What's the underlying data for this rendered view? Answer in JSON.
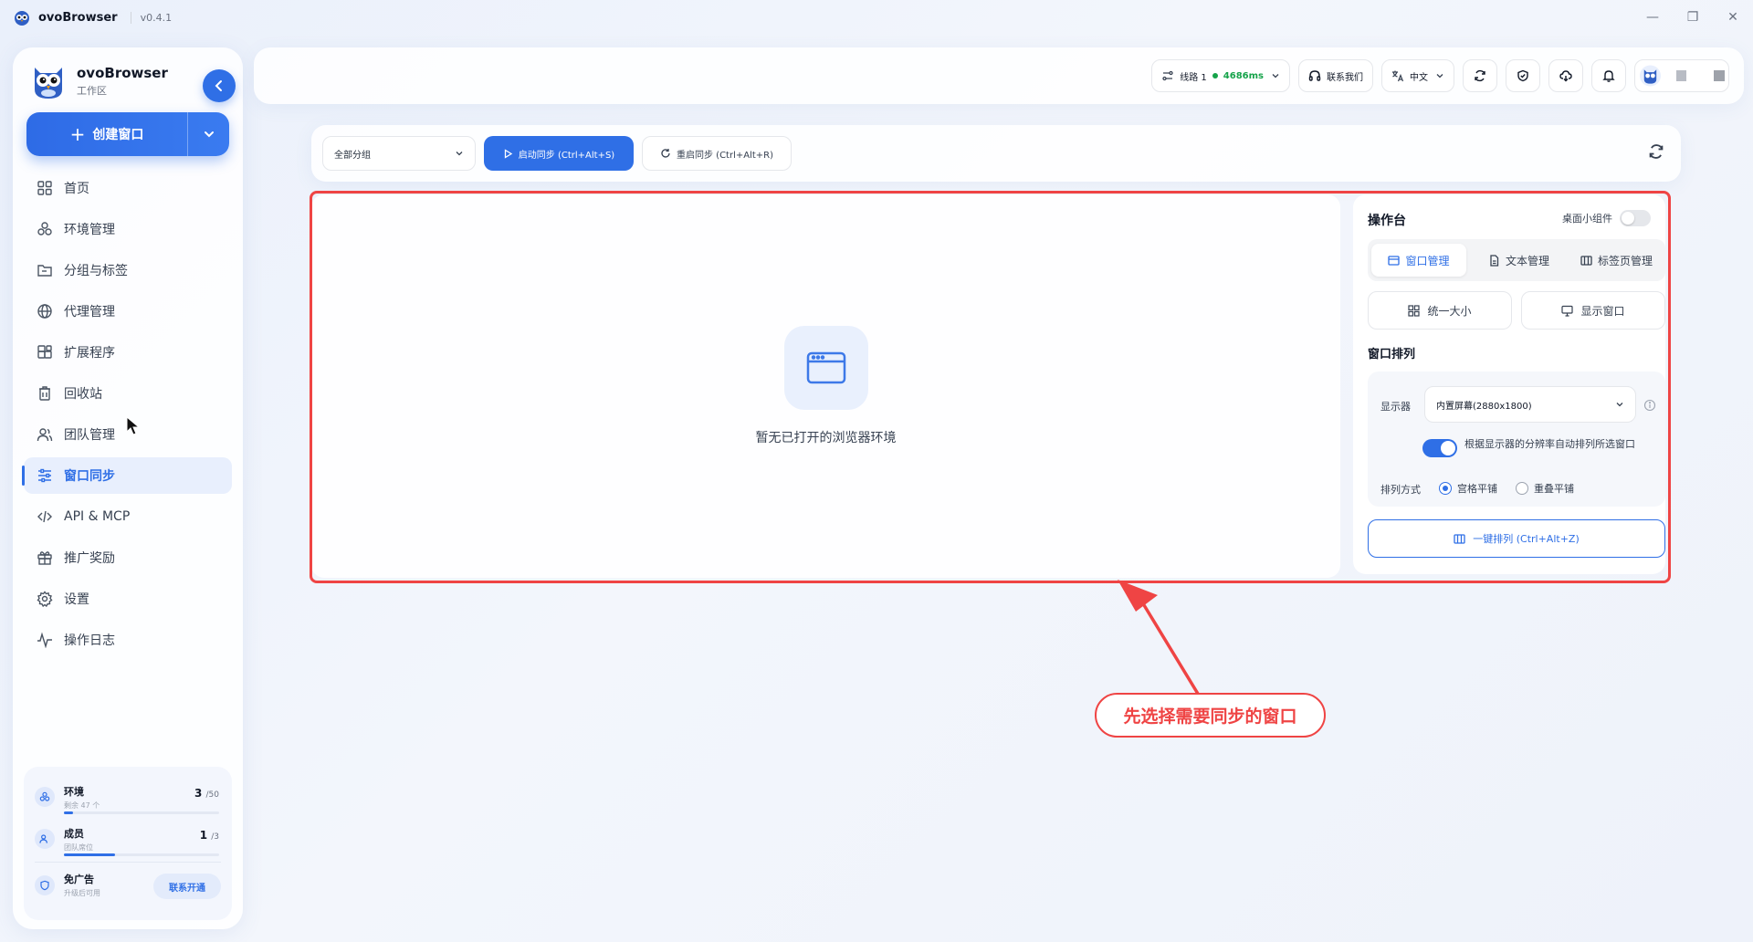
{
  "titlebar": {
    "app_name": "ovoBrowser",
    "version": "v0.4.1"
  },
  "sidebar": {
    "brand_name": "ovoBrowser",
    "brand_sub": "工作区",
    "create_label": "创建窗口",
    "items": [
      {
        "label": "首页",
        "icon": "grid-icon"
      },
      {
        "label": "环境管理",
        "icon": "cubes-icon"
      },
      {
        "label": "分组与标签",
        "icon": "folder-tag-icon"
      },
      {
        "label": "代理管理",
        "icon": "globe-icon"
      },
      {
        "label": "扩展程序",
        "icon": "puzzle-icon"
      },
      {
        "label": "回收站",
        "icon": "trash-icon"
      },
      {
        "label": "团队管理",
        "icon": "users-icon"
      },
      {
        "label": "窗口同步",
        "icon": "sliders-icon",
        "active": true
      },
      {
        "label": "API & MCP",
        "icon": "code-icon"
      },
      {
        "label": "推广奖励",
        "icon": "gift-icon"
      },
      {
        "label": "设置",
        "icon": "gear-icon"
      },
      {
        "label": "操作日志",
        "icon": "activity-icon"
      }
    ],
    "quota": {
      "env": {
        "title": "环境",
        "sub": "剩余 47 个",
        "count": "3",
        "total": "/50",
        "progress": 0.06
      },
      "member": {
        "title": "成员",
        "sub": "团队席位",
        "count": "1",
        "total": "/3",
        "progress": 0.33
      },
      "adfree": {
        "title": "免广告",
        "sub": "升级后可用",
        "button": "联系开通"
      }
    }
  },
  "header": {
    "line_label": "线路 1",
    "latency": "4686ms",
    "contact_label": "联系我们",
    "lang_label": "中文"
  },
  "toolbar": {
    "group_select": "全部分组",
    "start_sync": "启动同步 (Ctrl+Alt+S)",
    "restart_sync": "重启同步 (Ctrl+Alt+R)"
  },
  "main": {
    "empty_text": "暂无已打开的浏览器环境"
  },
  "console": {
    "title": "操作台",
    "widget_label": "桌面小组件",
    "tabs": [
      "窗口管理",
      "文本管理",
      "标签页管理"
    ],
    "btn_unify": "统一大小",
    "btn_show": "显示窗口",
    "arrange_title": "窗口排列",
    "monitor_label": "显示器",
    "monitor_value": "内置屏幕(2880x1800)",
    "auto_text": "根据显示器的分辨率自动排列所选窗口",
    "arrange_mode_label": "排列方式",
    "mode_grid": "宫格平铺",
    "mode_overlap": "重叠平铺",
    "onekey": "一键排列 (Ctrl+Alt+Z)"
  },
  "annotation": {
    "text": "先选择需要同步的窗口"
  },
  "colors": {
    "accent": "#2f6fe6",
    "annotation": "#ef4444",
    "online": "#16a34a"
  }
}
